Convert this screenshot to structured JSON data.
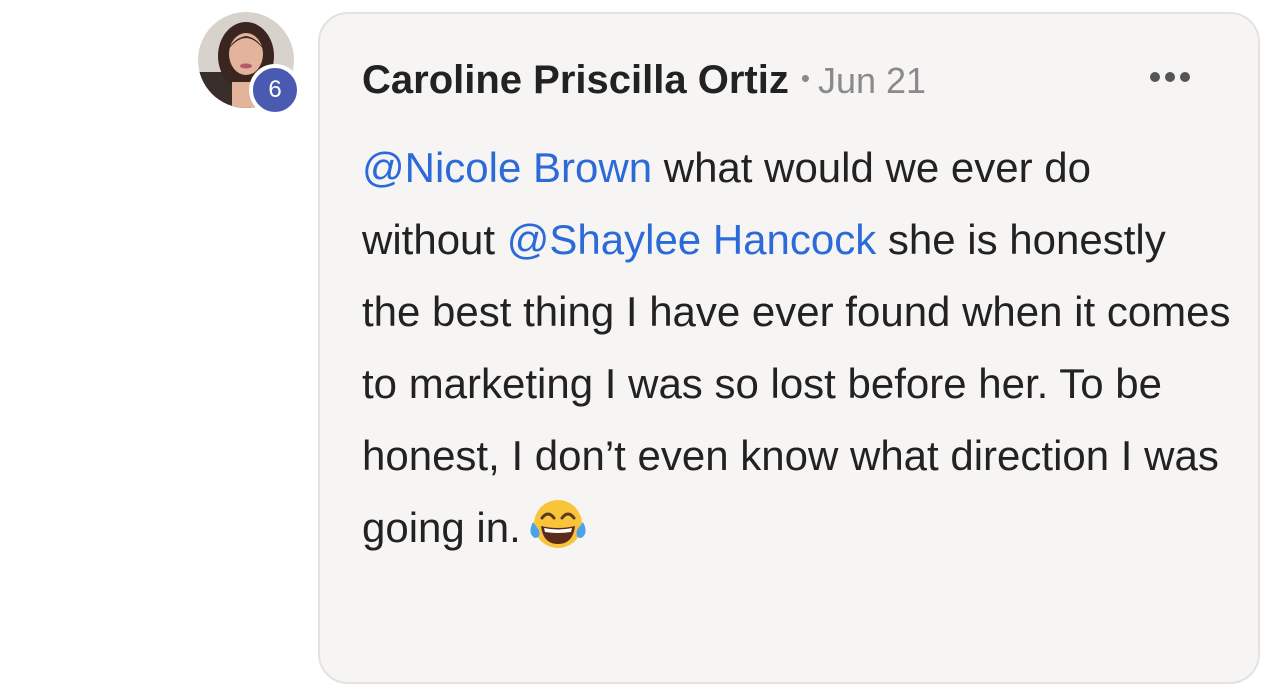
{
  "comment": {
    "author": "Caroline Priscilla Ortiz",
    "separator": "•",
    "date": "Jun 21",
    "level": "6",
    "text": {
      "mention_1": "@Nicole Brown",
      "segment_1": " what would we ever do without ",
      "mention_2": "@Shaylee Hancock",
      "segment_2": " she is honestly the best thing I have ever found when it comes to marketing I was so lost before her. To be honest, I don’t even know what direction I was going in.",
      "emoji": "face-with-tears-of-joy"
    }
  },
  "icons": {
    "more": "more-horizontal-icon"
  },
  "colors": {
    "mention": "#2b6ad8",
    "badge": "#4a5ab0",
    "bubble_bg": "#f6f5f4",
    "meta": "#8a8a8a"
  }
}
